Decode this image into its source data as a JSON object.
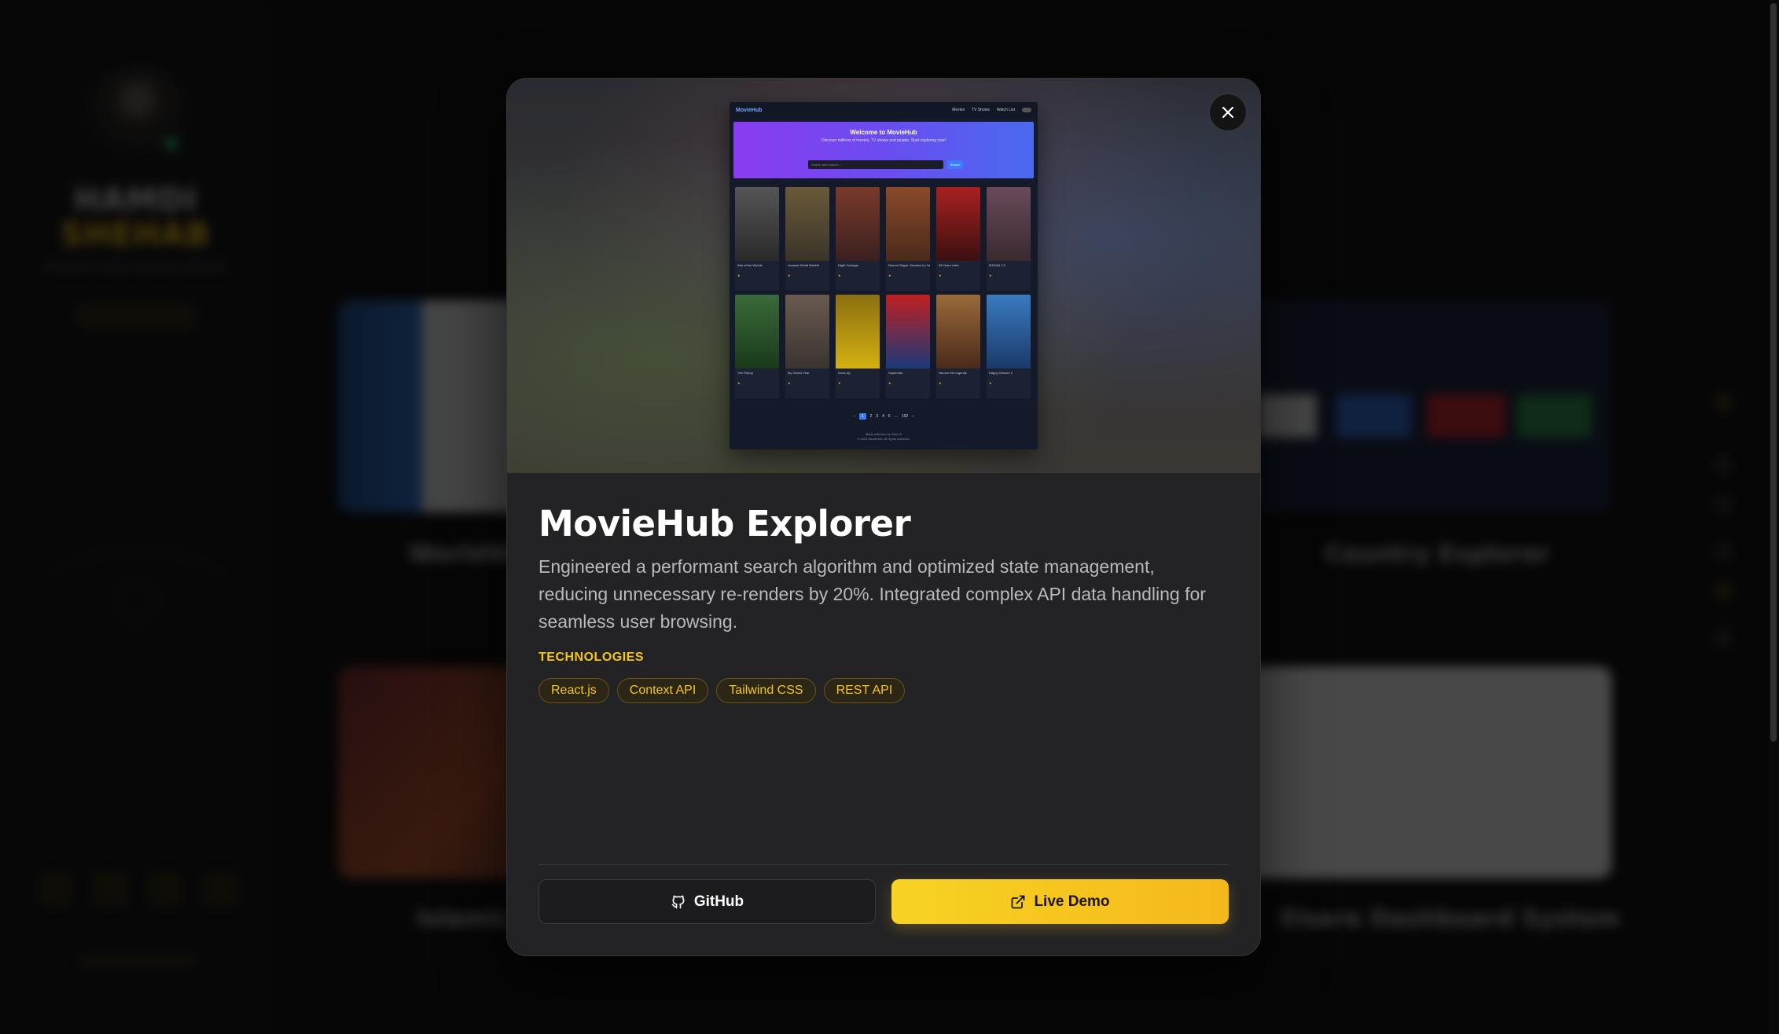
{
  "background": {
    "profile": {
      "first_name": "HAMDI",
      "last_name": "SHEHAB",
      "role": "FRONT-END DEVELOPER"
    },
    "cards": [
      {
        "title": "WorldWi"
      },
      {
        "title": "Country Explorer"
      },
      {
        "title": "Islamic P"
      },
      {
        "title": "Elsere Dashboard System"
      }
    ]
  },
  "modal": {
    "preview": {
      "app_name": "MovieHub",
      "nav_links": [
        "Movies",
        "TV Shows",
        "Watch List"
      ],
      "hero_title": "Welcome to MovieHub",
      "hero_subtitle": "Discover millions of movies, TV shows and people. Start exploring now!",
      "search_placeholder": "Search and explore...",
      "search_button": "Search",
      "row1": [
        "War of the Worlds",
        "Jurassic World Rebirth",
        "Night Carnage",
        "Demon Slayer: Kimetsu no Yaiba Infinity Castle",
        "28 Years Later",
        "M3GAN 2.0"
      ],
      "row2": [
        "The Pickup",
        "My Oxford Year",
        "Guns Up",
        "Superman",
        "Heroes Kill Legends",
        "Happy Gilmore 2"
      ],
      "pager": [
        "‹",
        "1",
        "2",
        "3",
        "4",
        "5",
        "...",
        "192",
        "›"
      ],
      "footer_line1": "Made with love by Shex ©",
      "footer_line2": "© 2025 MovieHub. All rights reserved."
    },
    "title": "MovieHub Explorer",
    "description": "Engineered a performant search algorithm and optimized state management, reducing unnecessary re-renders by 20%. Integrated complex API data handling for seamless user browsing.",
    "technologies_label": "TECHNOLOGIES",
    "technologies": [
      "React.js",
      "Context API",
      "Tailwind CSS",
      "REST API"
    ],
    "github_label": "GitHub",
    "demo_label": "Live Demo",
    "colors": {
      "accent": "#f5c518",
      "modal_bg": "#232325"
    }
  }
}
